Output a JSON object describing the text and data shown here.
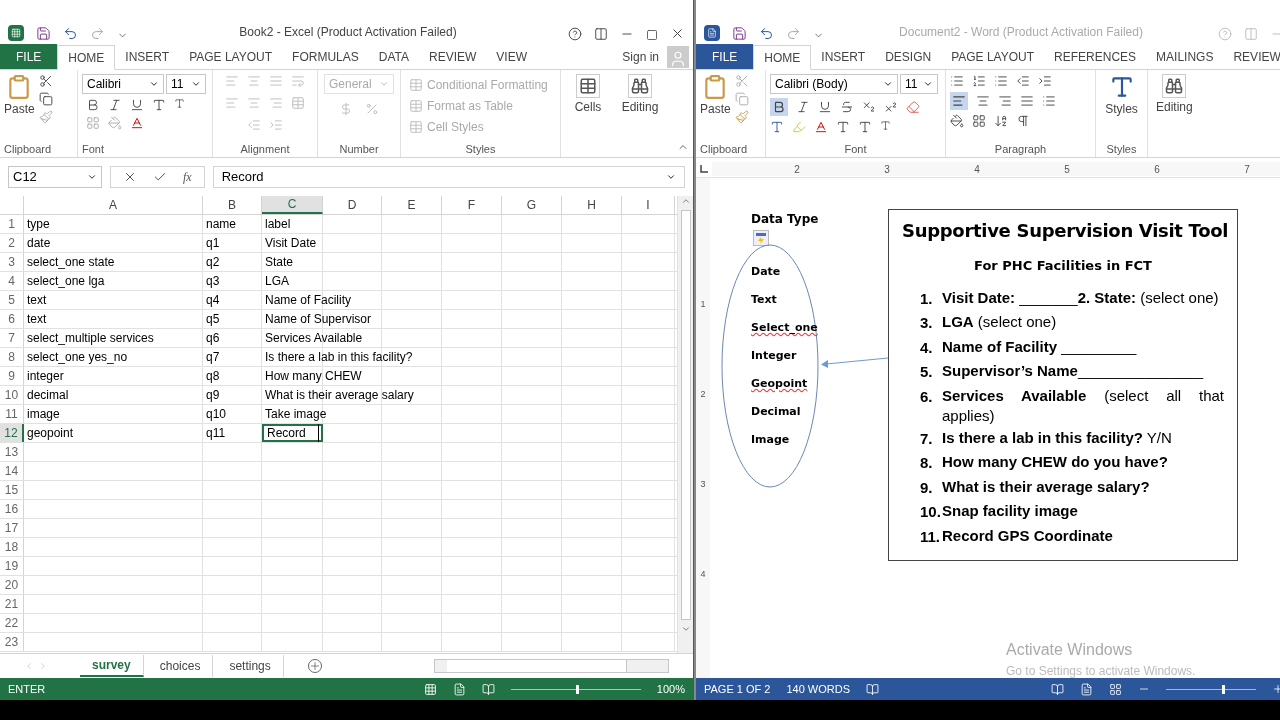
{
  "excel": {
    "title": "Book2 - Excel (Product Activation Failed)",
    "tabs": [
      {
        "label": "FILE",
        "kind": "file",
        "selected": false
      },
      {
        "label": "HOME",
        "kind": "tab",
        "selected": true
      },
      {
        "label": "INSERT",
        "kind": "tab",
        "selected": false
      },
      {
        "label": "PAGE LAYOUT",
        "kind": "tab",
        "selected": false
      },
      {
        "label": "FORMULAS",
        "kind": "tab",
        "selected": false
      },
      {
        "label": "DATA",
        "kind": "tab",
        "selected": false
      },
      {
        "label": "REVIEW",
        "kind": "tab",
        "selected": false
      },
      {
        "label": "VIEW",
        "kind": "tab",
        "selected": false
      }
    ],
    "sign_in": "Sign in",
    "ribbon": {
      "paste": "Paste",
      "font": "Calibri",
      "size": "11",
      "number_format": "General",
      "styles": [
        "Conditional Formatting",
        "Format as Table",
        "Cell Styles"
      ],
      "cells": "Cells",
      "editing": "Editing",
      "groups": [
        "Clipboard",
        "Font",
        "Alignment",
        "Number",
        "Styles"
      ]
    },
    "name_box": "C12",
    "function_label": "fx",
    "formula": "Record",
    "columns": [
      {
        "label": "A",
        "selected": false
      },
      {
        "label": "B",
        "selected": false
      },
      {
        "label": "C",
        "selected": true
      },
      {
        "label": "D",
        "selected": false
      },
      {
        "label": "E",
        "selected": false
      },
      {
        "label": "F",
        "selected": false
      },
      {
        "label": "G",
        "selected": false
      },
      {
        "label": "H",
        "selected": false
      },
      {
        "label": "I",
        "selected": false
      }
    ],
    "rows": [
      {
        "number": "1",
        "selected": false,
        "cells": [
          "type",
          "name",
          "label"
        ]
      },
      {
        "number": "2",
        "selected": false,
        "cells": [
          "date",
          "q1",
          "Visit Date"
        ]
      },
      {
        "number": "3",
        "selected": false,
        "cells": [
          "select_one state",
          "q2",
          "State"
        ]
      },
      {
        "number": "4",
        "selected": false,
        "cells": [
          "select_one lga",
          "q3",
          "LGA"
        ]
      },
      {
        "number": "5",
        "selected": false,
        "cells": [
          "text",
          "q4",
          "Name of Facility"
        ]
      },
      {
        "number": "6",
        "selected": false,
        "cells": [
          "text",
          "q5",
          "Name of Supervisor"
        ]
      },
      {
        "number": "7",
        "selected": false,
        "cells": [
          "select_multiple services",
          "q6",
          "Services Available"
        ]
      },
      {
        "number": "8",
        "selected": false,
        "cells": [
          "select_one yes_no",
          "q7",
          "Is there a lab in this facility?"
        ]
      },
      {
        "number": "9",
        "selected": false,
        "cells": [
          "integer",
          "q8",
          "How many CHEW"
        ]
      },
      {
        "number": "10",
        "selected": false,
        "cells": [
          "decimal",
          "q9",
          "What is their average salary"
        ]
      },
      {
        "number": "11",
        "selected": false,
        "cells": [
          "image",
          "q10",
          "Take image"
        ]
      },
      {
        "number": "12",
        "selected": true,
        "cells": [
          "geopoint",
          "q11",
          "Record"
        ]
      },
      {
        "number": "13",
        "selected": false
      },
      {
        "number": "14",
        "selected": false
      },
      {
        "number": "15",
        "selected": false
      },
      {
        "number": "16",
        "selected": false
      },
      {
        "number": "17",
        "selected": false
      },
      {
        "number": "18",
        "selected": false
      },
      {
        "number": "19",
        "selected": false
      },
      {
        "number": "20",
        "selected": false
      },
      {
        "number": "21",
        "selected": false
      },
      {
        "number": "22",
        "selected": false
      },
      {
        "number": "23",
        "selected": false
      }
    ],
    "sheets": [
      {
        "label": "survey",
        "selected": true
      },
      {
        "label": "choices",
        "selected": false
      },
      {
        "label": "settings",
        "selected": false
      }
    ],
    "status": "ENTER",
    "zoom": "100%",
    "zoom_slider": {
      "level": 0.5
    }
  },
  "word": {
    "title": "Document2 - Word (Product Activation Failed)",
    "tabs": [
      {
        "label": "FILE",
        "kind": "file",
        "selected": false
      },
      {
        "label": "HOME",
        "kind": "tab",
        "selected": true
      },
      {
        "label": "INSERT",
        "kind": "tab",
        "selected": false
      },
      {
        "label": "DESIGN",
        "kind": "tab",
        "selected": false
      },
      {
        "label": "PAGE LAYOUT",
        "kind": "tab",
        "selected": false
      },
      {
        "label": "REFERENCES",
        "kind": "tab",
        "selected": false
      },
      {
        "label": "MAILINGS",
        "kind": "tab",
        "selected": false
      },
      {
        "label": "REVIEW",
        "kind": "tab",
        "selected": false
      }
    ],
    "ribbon": {
      "paste": "Paste",
      "font": "Calibri (Body)",
      "size": "11",
      "bold_active": true,
      "align_left_active": true,
      "styles": "Styles",
      "editing": "Editing",
      "groups": [
        "Clipboard",
        "Font",
        "Paragraph",
        "Styles"
      ]
    },
    "ruler": [
      "2",
      "3",
      "4",
      "5",
      "6",
      "7"
    ],
    "vertical_ruler": [
      "1",
      "2",
      "3",
      "4"
    ],
    "document": {
      "data_type_label": "Data Type",
      "data_types": [
        {
          "text": "Date",
          "misspelled": false
        },
        {
          "text": "Text",
          "misspelled": false
        },
        {
          "text": "Select_one",
          "misspelled": true
        },
        {
          "text": "Integer",
          "misspelled": false
        },
        {
          "text": "Geopoint",
          "misspelled": true
        },
        {
          "text": "Decimal",
          "misspelled": false
        },
        {
          "text": "Image",
          "misspelled": false
        }
      ],
      "box": {
        "title": "Supportive Supervision Visit Tool",
        "subtitle": "For PHC Facilities in FCT",
        "items": [
          {
            "number": "1.",
            "text": "**Visit Date:** _______**2. State:** (select one)"
          },
          {
            "number": "3.",
            "text": "**LGA** (select one)"
          },
          {
            "number": "4.",
            "text": "**Name of Facility** _________"
          },
          {
            "number": "5.",
            "text": "**Supervisor’s Name**_______________"
          },
          {
            "number": "6.",
            "text": "**Services Available** (select all that applies)"
          },
          {
            "number": "7.",
            "text": "**Is there a lab in this facility?** Y/N"
          },
          {
            "number": "8.",
            "text": "**How many CHEW do you have?**"
          },
          {
            "number": "9.",
            "text": "**What is their average salary?**"
          },
          {
            "number": "10.",
            "text": "**Snap facility image**"
          },
          {
            "number": "11.",
            "text": "**Record GPS Coordinate**"
          }
        ]
      }
    },
    "status": {
      "page": "PAGE 1 OF 2",
      "words": "140 WORDS"
    },
    "zoom_slider": {
      "level": 0.62
    }
  },
  "activation": {
    "title": "Activate Windows",
    "hint": "Go to Settings to activate Windows."
  }
}
